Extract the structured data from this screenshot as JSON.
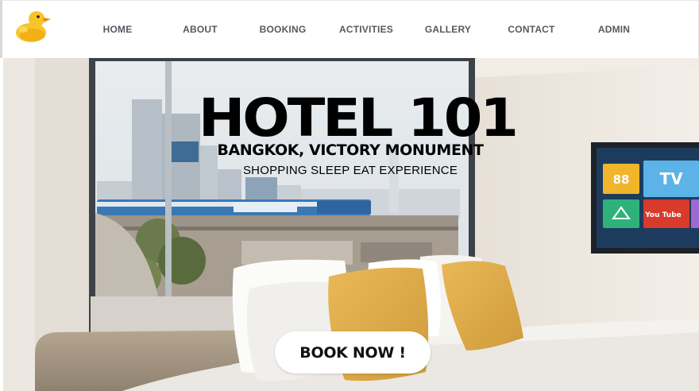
{
  "nav": {
    "logo_icon": "duck-logo-icon",
    "links": [
      "HOME",
      "ABOUT",
      "BOOKING",
      "ACTIVITIES",
      "GALLERY",
      "CONTACT",
      "ADMIN"
    ]
  },
  "hero": {
    "title": "HOTEL 101",
    "subtitle": "BANGKOK, VICTORY MONUMENT",
    "tagline": "SHOPPING SLEEP EAT EXPERIENCE",
    "cta_label": "BOOK NOW !",
    "tv_tiles": {
      "tile1": "88",
      "tile2": "TV",
      "tile4": "You Tube"
    }
  },
  "colors": {
    "nav_text": "#555a60",
    "cushion_yellow": "#e0ad4c",
    "cta_background": "#ffffff"
  }
}
